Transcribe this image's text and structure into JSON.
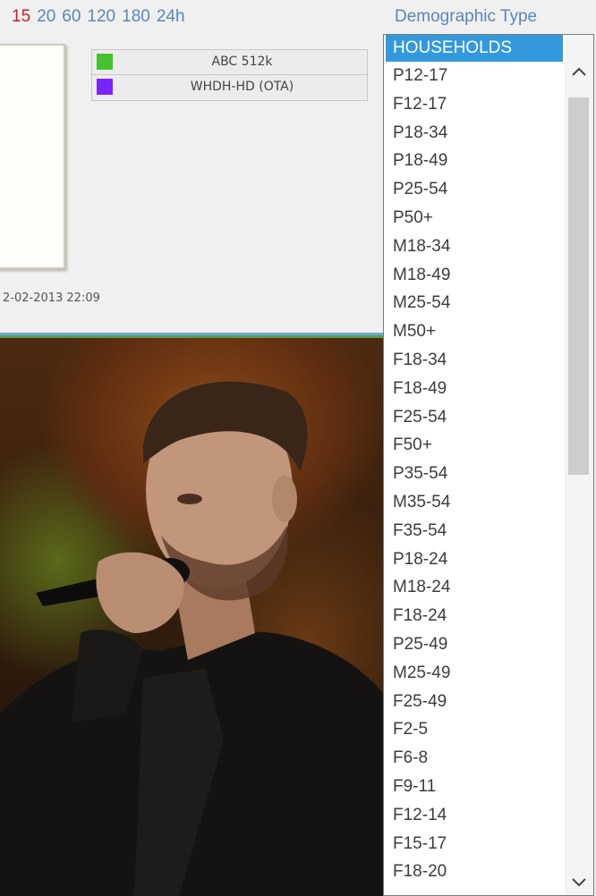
{
  "time_intervals": {
    "items": [
      {
        "label": "15",
        "color": "#d02020"
      },
      {
        "label": "20",
        "color": "#5b86b8"
      },
      {
        "label": "60",
        "color": "#5b86b8"
      },
      {
        "label": "120",
        "color": "#5b86b8"
      },
      {
        "label": "180",
        "color": "#5b86b8"
      },
      {
        "label": "24h",
        "color": "#5b86b8"
      }
    ]
  },
  "demographic": {
    "link_label": "Demographic Type",
    "selected": "HOUSEHOLDS",
    "options": [
      "HOUSEHOLDS",
      "P12-17",
      "F12-17",
      "P18-34",
      "P18-49",
      "P25-54",
      "P50+",
      "M18-34",
      "M18-49",
      "M25-54",
      "M50+",
      "F18-34",
      "F18-49",
      "F25-54",
      "F50+",
      "P35-54",
      "M35-54",
      "F35-54",
      "P18-24",
      "M18-24",
      "F18-24",
      "P25-49",
      "M25-49",
      "F25-49",
      "F2-5",
      "F6-8",
      "F9-11",
      "F12-14",
      "F15-17",
      "F18-20"
    ]
  },
  "legend": {
    "items": [
      {
        "label": "ABC 512k",
        "color": "#46c22c"
      },
      {
        "label": "WHDH-HD (OTA)",
        "color": "#7a22ff"
      }
    ]
  },
  "timestamp": "2-02-2013 22:09",
  "scrollbar": {
    "up_icon": "chevron-up-icon",
    "down_icon": "chevron-down-icon"
  }
}
